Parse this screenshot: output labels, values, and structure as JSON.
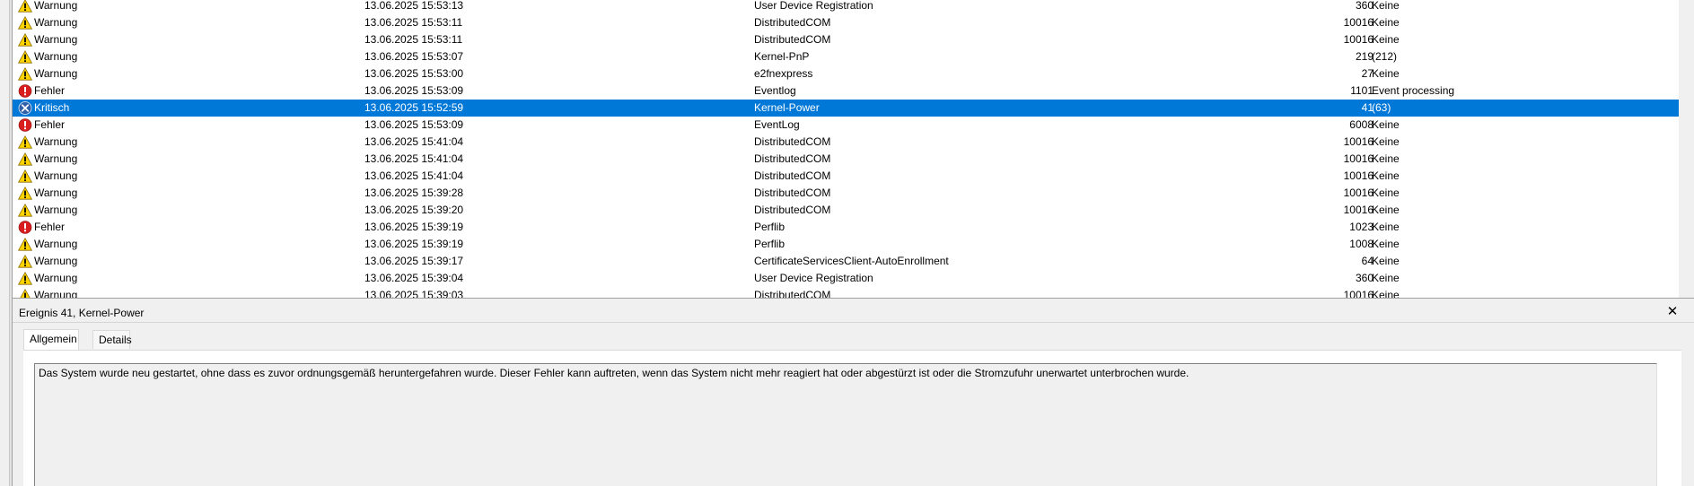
{
  "events": [
    {
      "level": "Warnung",
      "icon": "warning-icon",
      "date": "13.06.2025 15:53:13",
      "source": "User Device Registration",
      "id": "360",
      "task": "Keine"
    },
    {
      "level": "Warnung",
      "icon": "warning-icon",
      "date": "13.06.2025 15:53:11",
      "source": "DistributedCOM",
      "id": "10016",
      "task": "Keine"
    },
    {
      "level": "Warnung",
      "icon": "warning-icon",
      "date": "13.06.2025 15:53:11",
      "source": "DistributedCOM",
      "id": "10016",
      "task": "Keine"
    },
    {
      "level": "Warnung",
      "icon": "warning-icon",
      "date": "13.06.2025 15:53:07",
      "source": "Kernel-PnP",
      "id": "219",
      "task": "(212)"
    },
    {
      "level": "Warnung",
      "icon": "warning-icon",
      "date": "13.06.2025 15:53:00",
      "source": "e2fnexpress",
      "id": "27",
      "task": "Keine"
    },
    {
      "level": "Fehler",
      "icon": "error-icon",
      "date": "13.06.2025 15:53:09",
      "source": "Eventlog",
      "id": "1101",
      "task": "Event processing"
    },
    {
      "level": "Kritisch",
      "icon": "critical-icon",
      "date": "13.06.2025 15:52:59",
      "source": "Kernel-Power",
      "id": "41",
      "task": "(63)",
      "selected": true
    },
    {
      "level": "Fehler",
      "icon": "error-icon",
      "date": "13.06.2025 15:53:09",
      "source": "EventLog",
      "id": "6008",
      "task": "Keine"
    },
    {
      "level": "Warnung",
      "icon": "warning-icon",
      "date": "13.06.2025 15:41:04",
      "source": "DistributedCOM",
      "id": "10016",
      "task": "Keine"
    },
    {
      "level": "Warnung",
      "icon": "warning-icon",
      "date": "13.06.2025 15:41:04",
      "source": "DistributedCOM",
      "id": "10016",
      "task": "Keine"
    },
    {
      "level": "Warnung",
      "icon": "warning-icon",
      "date": "13.06.2025 15:41:04",
      "source": "DistributedCOM",
      "id": "10016",
      "task": "Keine"
    },
    {
      "level": "Warnung",
      "icon": "warning-icon",
      "date": "13.06.2025 15:39:28",
      "source": "DistributedCOM",
      "id": "10016",
      "task": "Keine"
    },
    {
      "level": "Warnung",
      "icon": "warning-icon",
      "date": "13.06.2025 15:39:20",
      "source": "DistributedCOM",
      "id": "10016",
      "task": "Keine"
    },
    {
      "level": "Fehler",
      "icon": "error-icon",
      "date": "13.06.2025 15:39:19",
      "source": "Perflib",
      "id": "1023",
      "task": "Keine"
    },
    {
      "level": "Warnung",
      "icon": "warning-icon",
      "date": "13.06.2025 15:39:19",
      "source": "Perflib",
      "id": "1008",
      "task": "Keine"
    },
    {
      "level": "Warnung",
      "icon": "warning-icon",
      "date": "13.06.2025 15:39:17",
      "source": "CertificateServicesClient-AutoEnrollment",
      "id": "64",
      "task": "Keine"
    },
    {
      "level": "Warnung",
      "icon": "warning-icon",
      "date": "13.06.2025 15:39:04",
      "source": "User Device Registration",
      "id": "360",
      "task": "Keine"
    },
    {
      "level": "Warnung",
      "icon": "warning-icon",
      "date": "13.06.2025 15:39:03",
      "source": "DistributedCOM",
      "id": "10016",
      "task": "Keine"
    }
  ],
  "detail": {
    "title": "Ereignis 41, Kernel-Power",
    "close_label": "✕",
    "tabs": [
      {
        "label": "Allgemein",
        "active": true
      },
      {
        "label": "Details",
        "active": false
      }
    ],
    "description": "Das System wurde neu gestartet, ohne dass es zuvor ordnungsgemäß heruntergefahren wurde. Dieser Fehler kann auftreten, wenn das System nicht mehr reagiert hat oder abgestürzt ist oder die Stromzufuhr unerwartet unterbrochen wurde."
  },
  "colors": {
    "selection": "#0078d7",
    "warning": "#ffd400",
    "error": "#d81e1e",
    "critical": "#2f5fa8"
  }
}
